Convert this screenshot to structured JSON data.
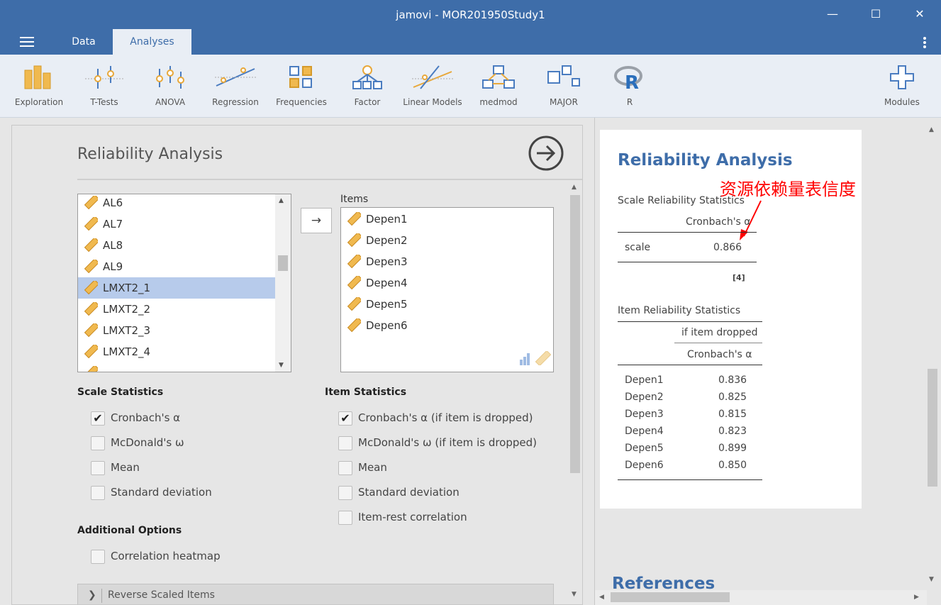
{
  "window": {
    "title": "jamovi - MOR201950Study1",
    "minimize": "—",
    "maximize": "☐",
    "close": "✕"
  },
  "tabs": {
    "data": "Data",
    "analyses": "Analyses"
  },
  "ribbon": [
    {
      "label": "Exploration",
      "icon": "bar-chart-icon"
    },
    {
      "label": "T-Tests",
      "icon": "t-test-icon"
    },
    {
      "label": "ANOVA",
      "icon": "anova-icon"
    },
    {
      "label": "Regression",
      "icon": "regression-icon"
    },
    {
      "label": "Frequencies",
      "icon": "frequencies-icon"
    },
    {
      "label": "Factor",
      "icon": "factor-icon"
    },
    {
      "label": "Linear Models",
      "icon": "linear-models-icon"
    },
    {
      "label": "medmod",
      "icon": "medmod-icon"
    },
    {
      "label": "MAJOR",
      "icon": "major-icon"
    },
    {
      "label": "R",
      "icon": "r-icon"
    },
    {
      "label": "Modules",
      "icon": "plus-icon"
    }
  ],
  "options": {
    "title": "Reliability Analysis",
    "move_arrow": "→",
    "source_vars": [
      "AL6",
      "AL7",
      "AL8",
      "AL9",
      "LMXT2_1",
      "LMXT2_2",
      "LMXT2_3",
      "LMXT2_4"
    ],
    "selected_source": "LMXT2_1",
    "items_label": "Items",
    "items": [
      "Depen1",
      "Depen2",
      "Depen3",
      "Depen4",
      "Depen5",
      "Depen6"
    ],
    "scale_stats": {
      "heading": "Scale Statistics",
      "checks": [
        {
          "label": "Cronbach's α",
          "checked": true
        },
        {
          "label": "McDonald's ω",
          "checked": false
        },
        {
          "label": "Mean",
          "checked": false
        },
        {
          "label": "Standard deviation",
          "checked": false
        }
      ]
    },
    "item_stats": {
      "heading": "Item Statistics",
      "checks": [
        {
          "label": "Cronbach's α (if item is dropped)",
          "checked": true
        },
        {
          "label": "McDonald's ω (if item is dropped)",
          "checked": false
        },
        {
          "label": "Mean",
          "checked": false
        },
        {
          "label": "Standard deviation",
          "checked": false
        },
        {
          "label": "Item-rest correlation",
          "checked": false
        }
      ]
    },
    "additional": {
      "heading": "Additional Options",
      "checks": [
        {
          "label": "Correlation heatmap",
          "checked": false
        }
      ]
    },
    "reverse_scaled": "Reverse Scaled Items"
  },
  "results": {
    "title": "Reliability Analysis",
    "scale_table": {
      "title": "Scale Reliability Statistics",
      "col": "Cronbach's α",
      "row_label": "scale",
      "value": "0.866",
      "footnote": "[4]"
    },
    "annotation": "资源依赖量表信度",
    "item_table": {
      "title": "Item Reliability Statistics",
      "super_header": "if item dropped",
      "col": "Cronbach's α",
      "rows": [
        {
          "item": "Depen1",
          "value": "0.836"
        },
        {
          "item": "Depen2",
          "value": "0.825"
        },
        {
          "item": "Depen3",
          "value": "0.815"
        },
        {
          "item": "Depen4",
          "value": "0.823"
        },
        {
          "item": "Depen5",
          "value": "0.899"
        },
        {
          "item": "Depen6",
          "value": "0.850"
        }
      ]
    },
    "references": "References"
  },
  "colors": {
    "brand": "#3e6da9",
    "ruler_icon": "#e8a83a",
    "selection": "#b7cbeb",
    "annotation": "#ff0000"
  }
}
